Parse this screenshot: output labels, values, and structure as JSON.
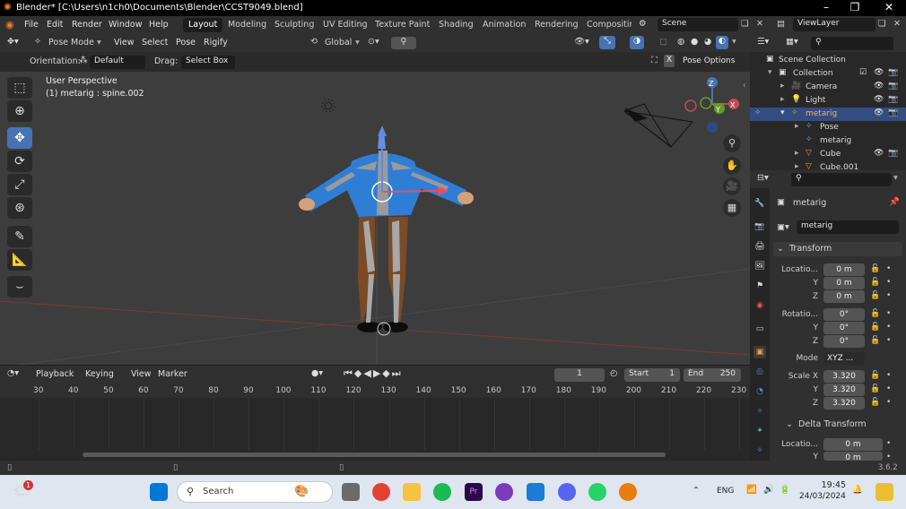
{
  "window": {
    "title": "Blender* [C:\\Users\\n1ch0\\Documents\\Blender\\CCST9049.blend]"
  },
  "menu": {
    "items": [
      "File",
      "Edit",
      "Render",
      "Window",
      "Help"
    ]
  },
  "workspaces": [
    "Layout",
    "Modeling",
    "Sculpting",
    "UV Editing",
    "Texture Paint",
    "Shading",
    "Animation",
    "Rendering",
    "Compositin"
  ],
  "scene": {
    "label": "Scene",
    "viewlayer": "ViewLayer"
  },
  "viewport_header": {
    "mode": "Pose Mode",
    "menus": [
      "View",
      "Select",
      "Pose",
      "Rigify"
    ],
    "transform_orientation": "Global",
    "orientation_label": "Orientation:",
    "orientation_value": "Default",
    "drag_label": "Drag:",
    "drag_value": "Select Box",
    "options": "Pose Options"
  },
  "viewport_overlay": {
    "line1": "User Perspective",
    "line2": "(1) metarig : spine.002"
  },
  "gizmo_axes": {
    "z": "Z",
    "y": "Y",
    "x": "X"
  },
  "timeline_header": {
    "menus": [
      "Playback",
      "Keying",
      "View",
      "Marker"
    ],
    "current_frame": "1",
    "start_label": "Start",
    "start": "1",
    "end_label": "End",
    "end": "250"
  },
  "timeline_ticks": [
    "30",
    "40",
    "50",
    "60",
    "70",
    "80",
    "90",
    "100",
    "110",
    "120",
    "130",
    "140",
    "150",
    "160",
    "170",
    "180",
    "190",
    "200",
    "210",
    "220",
    "230"
  ],
  "outliner": {
    "rows": [
      {
        "label": "Scene Collection"
      },
      {
        "label": "Collection"
      },
      {
        "label": "Camera"
      },
      {
        "label": "Light"
      },
      {
        "label": "metarig"
      },
      {
        "label": "Pose"
      },
      {
        "label": "metarig"
      },
      {
        "label": "Cube"
      },
      {
        "label": "Cube.001"
      }
    ]
  },
  "properties": {
    "object_name": "metarig",
    "data_name": "metarig",
    "transform_title": "Transform",
    "location_label": "Locatio...",
    "location": [
      "0 m",
      "0 m",
      "0 m"
    ],
    "rotation_label": "Rotatio...",
    "rotation": [
      "0°",
      "0°",
      "0°"
    ],
    "mode_label": "Mode",
    "mode_value": "XYZ ...",
    "scale_label": "Scale X",
    "scale": [
      "3.320",
      "3.320",
      "3.320"
    ],
    "axis_y": "Y",
    "axis_z": "Z",
    "delta_title": "Delta Transform",
    "delta_location_label": "Locatio...",
    "delta_location": [
      "0 m",
      "0 m"
    ]
  },
  "status": {
    "version": "3.6.2"
  },
  "taskbar": {
    "search_placeholder": "Search",
    "lang": "ENG",
    "time": "19:45",
    "date": "24/03/2024",
    "badge": "1"
  }
}
